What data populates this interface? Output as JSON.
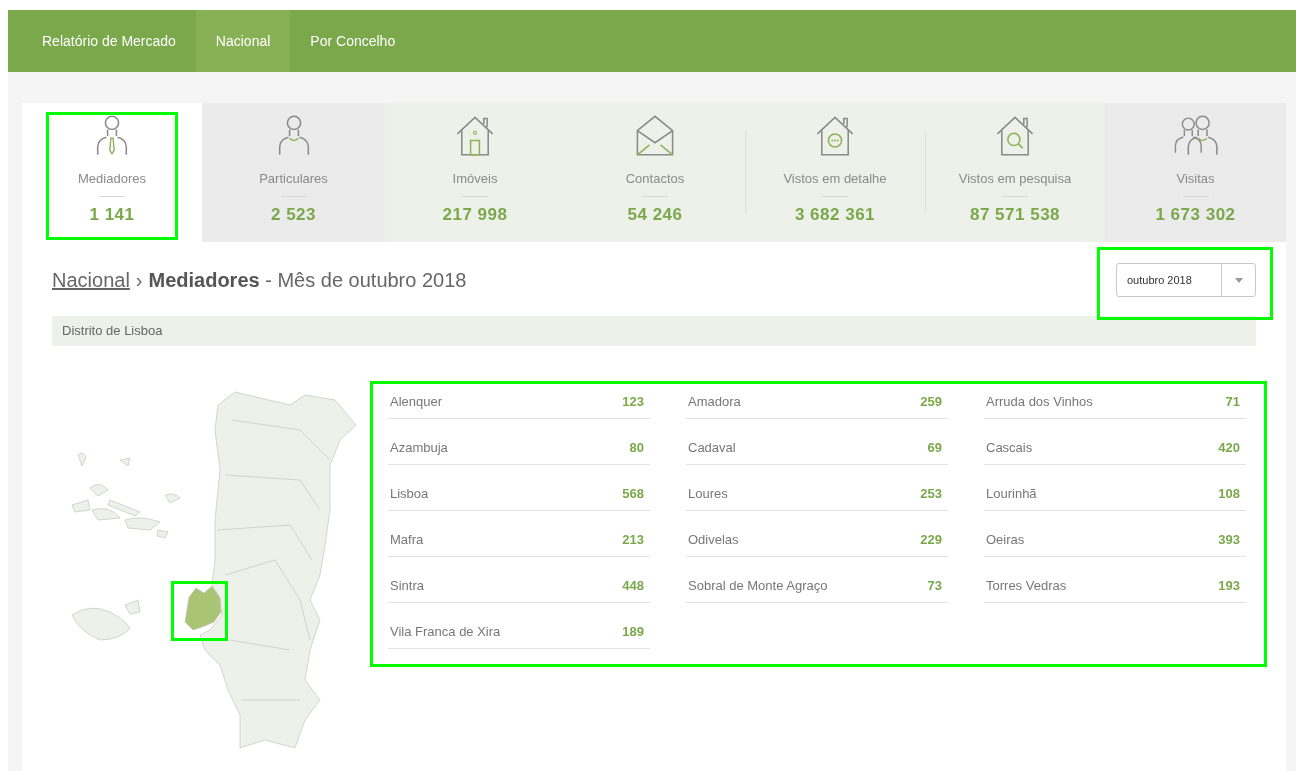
{
  "navbar": {
    "items": [
      {
        "label": "Relatório de Mercado",
        "selected": false
      },
      {
        "label": "Nacional",
        "selected": true
      },
      {
        "label": "Por Concelho",
        "selected": false
      }
    ]
  },
  "stats": [
    {
      "kind": "person-tie",
      "label": "Mediadores",
      "value": "1 141",
      "selected": true,
      "highlighted": true
    },
    {
      "kind": "person",
      "label": "Particulares",
      "value": "2 523",
      "selected": false,
      "highlighted": false
    },
    {
      "kind": "house",
      "label": "Imóveis",
      "value": "217 998",
      "selected": false,
      "highlighted": false
    },
    {
      "kind": "envelope",
      "label": "Contactos",
      "value": "54 246",
      "selected": false,
      "highlighted": false
    },
    {
      "kind": "house-chat",
      "label": "Vistos em detalhe",
      "value": "3 682 361",
      "selected": false,
      "highlighted": false
    },
    {
      "kind": "house-search",
      "label": "Vistos em pesquisa",
      "value": "87 571 538",
      "selected": false,
      "highlighted": false
    },
    {
      "kind": "people",
      "label": "Visitas",
      "value": "1 673 302",
      "selected": false,
      "highlighted": false
    }
  ],
  "breadcrumb": {
    "link": "Nacional",
    "separator": "›",
    "title": "**Mediadores** - Mês de outubro 2018"
  },
  "month_select": {
    "value": "outubro 2018",
    "highlighted": true
  },
  "district_bar": "Distrito de Lisboa",
  "map": {
    "district_selected": true,
    "highlighted": true
  },
  "municipalities": {
    "highlighted": true,
    "items": [
      {
        "name": "Alenquer",
        "value": "123"
      },
      {
        "name": "Amadora",
        "value": "259"
      },
      {
        "name": "Arruda dos Vinhos",
        "value": "71"
      },
      {
        "name": "Azambuja",
        "value": "80"
      },
      {
        "name": "Cadaval",
        "value": "69"
      },
      {
        "name": "Cascais",
        "value": "420"
      },
      {
        "name": "Lisboa",
        "value": "568"
      },
      {
        "name": "Loures",
        "value": "253"
      },
      {
        "name": "Lourinhã",
        "value": "108"
      },
      {
        "name": "Mafra",
        "value": "213"
      },
      {
        "name": "Odivelas",
        "value": "229"
      },
      {
        "name": "Oeiras",
        "value": "393"
      },
      {
        "name": "Sintra",
        "value": "448"
      },
      {
        "name": "Sobral de Monte Agraço",
        "value": "73"
      },
      {
        "name": "Torres Vedras",
        "value": "193"
      },
      {
        "name": "Vila Franca de Xira",
        "value": "189"
      }
    ]
  }
}
